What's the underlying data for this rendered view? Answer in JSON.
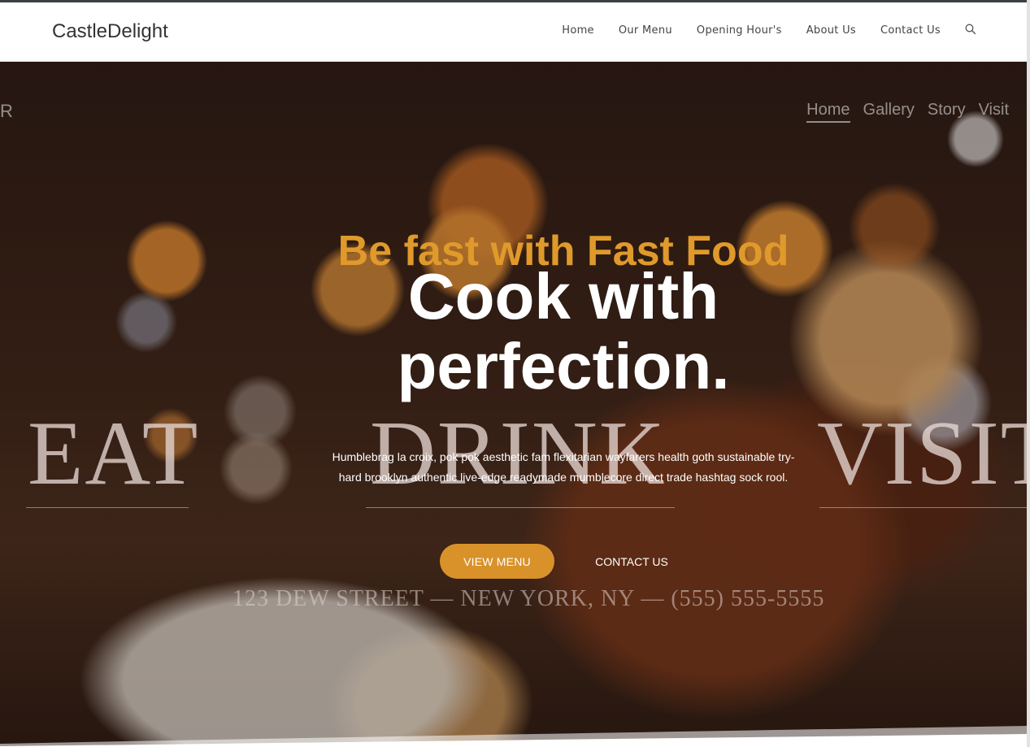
{
  "header": {
    "brand": "CastleDelight",
    "nav": [
      "Home",
      "Our Menu",
      "Opening Hour's",
      "About Us",
      "Contact Us"
    ],
    "search_icon": "search-icon"
  },
  "hero": {
    "subtitle": "Be fast with Fast Food",
    "headline_line1": "Cook with",
    "headline_line2": "perfection.",
    "description": "Humblebrag la croix, pok pok aesthetic fam flexitarian wayfarers health goth sustainable try-hard brooklyn authentic live-edge readymade mumblecore direct trade hashtag sock rool.",
    "primary_button": "VIEW MENU",
    "secondary_button": "CONTACT US",
    "accent_color": "#d9922a"
  }
}
